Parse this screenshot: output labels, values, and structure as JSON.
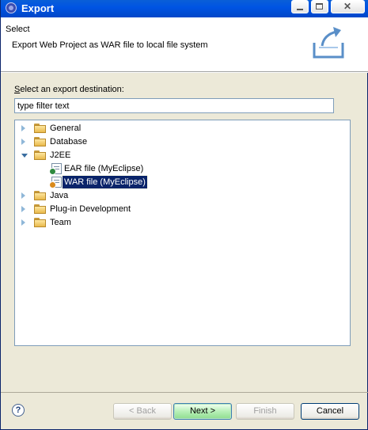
{
  "window": {
    "title": "Export"
  },
  "header": {
    "title": "Select",
    "description": "Export Web Project as WAR file to local file system"
  },
  "destination": {
    "label_first": "S",
    "label_rest": "elect an export destination:",
    "filter_value": "type filter text"
  },
  "tree": {
    "general": "General",
    "database": "Database",
    "j2ee": "J2EE",
    "ear": "EAR file (MyEclipse)",
    "war": "WAR file (MyEclipse)",
    "java": "Java",
    "plugin": "Plug-in Development",
    "team": "Team"
  },
  "buttons": {
    "back": "< Back",
    "next": "Next >",
    "finish": "Finish",
    "cancel": "Cancel",
    "help": "?"
  }
}
